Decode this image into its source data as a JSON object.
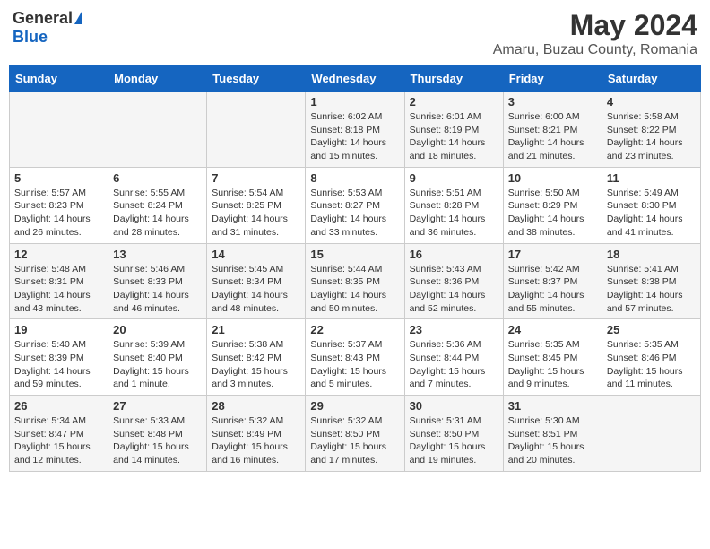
{
  "header": {
    "logo_general": "General",
    "logo_blue": "Blue",
    "month_title": "May 2024",
    "subtitle": "Amaru, Buzau County, Romania"
  },
  "days_of_week": [
    "Sunday",
    "Monday",
    "Tuesday",
    "Wednesday",
    "Thursday",
    "Friday",
    "Saturday"
  ],
  "weeks": [
    [
      {
        "day": "",
        "info": ""
      },
      {
        "day": "",
        "info": ""
      },
      {
        "day": "",
        "info": ""
      },
      {
        "day": "1",
        "info": "Sunrise: 6:02 AM\nSunset: 8:18 PM\nDaylight: 14 hours\nand 15 minutes."
      },
      {
        "day": "2",
        "info": "Sunrise: 6:01 AM\nSunset: 8:19 PM\nDaylight: 14 hours\nand 18 minutes."
      },
      {
        "day": "3",
        "info": "Sunrise: 6:00 AM\nSunset: 8:21 PM\nDaylight: 14 hours\nand 21 minutes."
      },
      {
        "day": "4",
        "info": "Sunrise: 5:58 AM\nSunset: 8:22 PM\nDaylight: 14 hours\nand 23 minutes."
      }
    ],
    [
      {
        "day": "5",
        "info": "Sunrise: 5:57 AM\nSunset: 8:23 PM\nDaylight: 14 hours\nand 26 minutes."
      },
      {
        "day": "6",
        "info": "Sunrise: 5:55 AM\nSunset: 8:24 PM\nDaylight: 14 hours\nand 28 minutes."
      },
      {
        "day": "7",
        "info": "Sunrise: 5:54 AM\nSunset: 8:25 PM\nDaylight: 14 hours\nand 31 minutes."
      },
      {
        "day": "8",
        "info": "Sunrise: 5:53 AM\nSunset: 8:27 PM\nDaylight: 14 hours\nand 33 minutes."
      },
      {
        "day": "9",
        "info": "Sunrise: 5:51 AM\nSunset: 8:28 PM\nDaylight: 14 hours\nand 36 minutes."
      },
      {
        "day": "10",
        "info": "Sunrise: 5:50 AM\nSunset: 8:29 PM\nDaylight: 14 hours\nand 38 minutes."
      },
      {
        "day": "11",
        "info": "Sunrise: 5:49 AM\nSunset: 8:30 PM\nDaylight: 14 hours\nand 41 minutes."
      }
    ],
    [
      {
        "day": "12",
        "info": "Sunrise: 5:48 AM\nSunset: 8:31 PM\nDaylight: 14 hours\nand 43 minutes."
      },
      {
        "day": "13",
        "info": "Sunrise: 5:46 AM\nSunset: 8:33 PM\nDaylight: 14 hours\nand 46 minutes."
      },
      {
        "day": "14",
        "info": "Sunrise: 5:45 AM\nSunset: 8:34 PM\nDaylight: 14 hours\nand 48 minutes."
      },
      {
        "day": "15",
        "info": "Sunrise: 5:44 AM\nSunset: 8:35 PM\nDaylight: 14 hours\nand 50 minutes."
      },
      {
        "day": "16",
        "info": "Sunrise: 5:43 AM\nSunset: 8:36 PM\nDaylight: 14 hours\nand 52 minutes."
      },
      {
        "day": "17",
        "info": "Sunrise: 5:42 AM\nSunset: 8:37 PM\nDaylight: 14 hours\nand 55 minutes."
      },
      {
        "day": "18",
        "info": "Sunrise: 5:41 AM\nSunset: 8:38 PM\nDaylight: 14 hours\nand 57 minutes."
      }
    ],
    [
      {
        "day": "19",
        "info": "Sunrise: 5:40 AM\nSunset: 8:39 PM\nDaylight: 14 hours\nand 59 minutes."
      },
      {
        "day": "20",
        "info": "Sunrise: 5:39 AM\nSunset: 8:40 PM\nDaylight: 15 hours\nand 1 minute."
      },
      {
        "day": "21",
        "info": "Sunrise: 5:38 AM\nSunset: 8:42 PM\nDaylight: 15 hours\nand 3 minutes."
      },
      {
        "day": "22",
        "info": "Sunrise: 5:37 AM\nSunset: 8:43 PM\nDaylight: 15 hours\nand 5 minutes."
      },
      {
        "day": "23",
        "info": "Sunrise: 5:36 AM\nSunset: 8:44 PM\nDaylight: 15 hours\nand 7 minutes."
      },
      {
        "day": "24",
        "info": "Sunrise: 5:35 AM\nSunset: 8:45 PM\nDaylight: 15 hours\nand 9 minutes."
      },
      {
        "day": "25",
        "info": "Sunrise: 5:35 AM\nSunset: 8:46 PM\nDaylight: 15 hours\nand 11 minutes."
      }
    ],
    [
      {
        "day": "26",
        "info": "Sunrise: 5:34 AM\nSunset: 8:47 PM\nDaylight: 15 hours\nand 12 minutes."
      },
      {
        "day": "27",
        "info": "Sunrise: 5:33 AM\nSunset: 8:48 PM\nDaylight: 15 hours\nand 14 minutes."
      },
      {
        "day": "28",
        "info": "Sunrise: 5:32 AM\nSunset: 8:49 PM\nDaylight: 15 hours\nand 16 minutes."
      },
      {
        "day": "29",
        "info": "Sunrise: 5:32 AM\nSunset: 8:50 PM\nDaylight: 15 hours\nand 17 minutes."
      },
      {
        "day": "30",
        "info": "Sunrise: 5:31 AM\nSunset: 8:50 PM\nDaylight: 15 hours\nand 19 minutes."
      },
      {
        "day": "31",
        "info": "Sunrise: 5:30 AM\nSunset: 8:51 PM\nDaylight: 15 hours\nand 20 minutes."
      },
      {
        "day": "",
        "info": ""
      }
    ]
  ]
}
